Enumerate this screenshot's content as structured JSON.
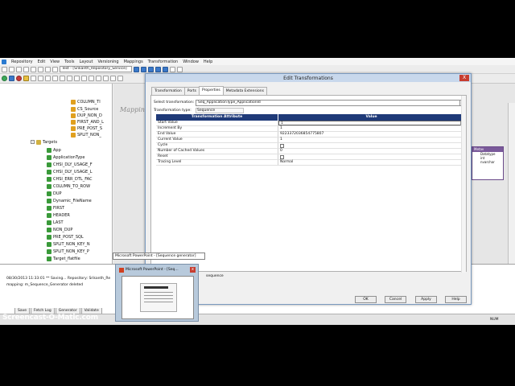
{
  "menu": [
    "Repository",
    "Edit",
    "View",
    "Tools",
    "Layout",
    "Versioning",
    "Mappings",
    "Transformation",
    "Window",
    "Help"
  ],
  "toolbar": {
    "repo_select": "Test - [Srikanth_Repository_Service]"
  },
  "navigator": {
    "sources": [
      "COLUMN_TI",
      "CS_Source",
      "DUP_NON_D",
      "FIRST_AND_L",
      "PRE_POST_S",
      "SPLIT_NON_"
    ],
    "targets_label": "Targets",
    "targets": [
      "App",
      "ApplicationType",
      "CHSI_DLY_USAGE_F",
      "CHSI_DLY_USAGE_L",
      "CHSI_ERR_DTL_FAC",
      "COLUMN_TO_ROW",
      "DUP",
      "Dynamic_FileName",
      "FIRST",
      "HEADER",
      "LAST",
      "NON_DUP",
      "PRE_POST_SQL",
      "SPLIT_NON_KEY_N",
      "SPLIT_NON_KEY_P",
      "Target_flatfile"
    ]
  },
  "workspace": {
    "label": "Mappin",
    "mapping_box": {
      "header": "Metav",
      "rows": [
        "Datatype",
        "int",
        "nvarchar"
      ]
    }
  },
  "output": {
    "line1": "08/30/2013 11:33:01 ** Saving... Repository: Srikanth_Re",
    "line2": "mapping: m_Sequence_Generator deleted",
    "tabs": [
      "Save",
      "Fetch Log",
      "Generator",
      "Validate"
    ]
  },
  "status": {
    "num": "NUM"
  },
  "dialog": {
    "title": "Edit Transformations",
    "close": "X",
    "tabs": [
      "Transformation",
      "Ports",
      "Properties",
      "Metadata Extensions"
    ],
    "active_tab": "Properties",
    "select_label": "Select transformation:",
    "select_value": "Seq_ApplicationType_ApplicationId",
    "type_label": "Transformation type:",
    "type_value": "Sequence",
    "grid_headers": [
      "Transformation Attribute",
      "Value"
    ],
    "rows": [
      {
        "attr": "Start Value",
        "value": "1"
      },
      {
        "attr": "Increment By",
        "value": "1"
      },
      {
        "attr": "End Value",
        "value": "9223372036854775807"
      },
      {
        "attr": "Current Value",
        "value": "1"
      },
      {
        "attr": "Cycle",
        "value": ""
      },
      {
        "attr": "Number of Cached Values",
        "value": "0"
      },
      {
        "attr": "Reset",
        "value": ""
      },
      {
        "attr": "Tracing Level",
        "value": "Normal"
      }
    ],
    "footer_text": "sequence",
    "buttons": {
      "ok": "OK",
      "cancel": "Cancel",
      "apply": "Apply",
      "help": "Help"
    }
  },
  "taskbar": {
    "tooltip": "Microsoft PowerPoint - [Sequence generator]",
    "thumb_title": "Microsoft PowerPoint - [Seq...",
    "thumb_close": "x"
  },
  "watermark": "Screencast-O-Matic.com"
}
